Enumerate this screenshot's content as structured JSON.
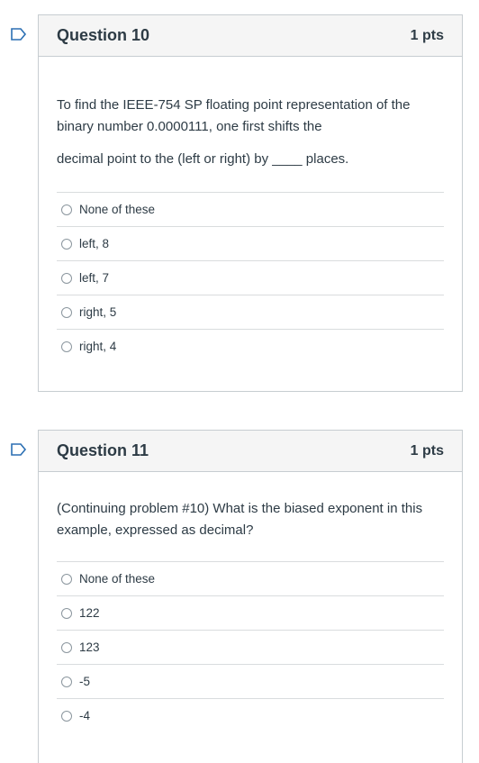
{
  "questions": [
    {
      "title": "Question 10",
      "points": "1 pts",
      "text_line1": "To find the IEEE-754 SP floating point representation of the binary number 0.0000111, one first shifts the",
      "text_line2": "decimal point to the (left or right) by ____ places.",
      "answers": [
        "None of these",
        "left, 8",
        "left, 7",
        "right, 5",
        "right, 4"
      ]
    },
    {
      "title": "Question 11",
      "points": "1 pts",
      "text_line1": "(Continuing problem #10) What is the biased exponent in this example, expressed as decimal?",
      "answers": [
        "None of these",
        "122",
        "123",
        "-5",
        "-4"
      ]
    }
  ],
  "colors": {
    "flag": "#2b6fb3",
    "border": "#c7cdd1",
    "header_bg": "#f5f5f5"
  },
  "icons": {
    "flag": "bookmark-flag-icon",
    "radio": "radio-icon"
  }
}
